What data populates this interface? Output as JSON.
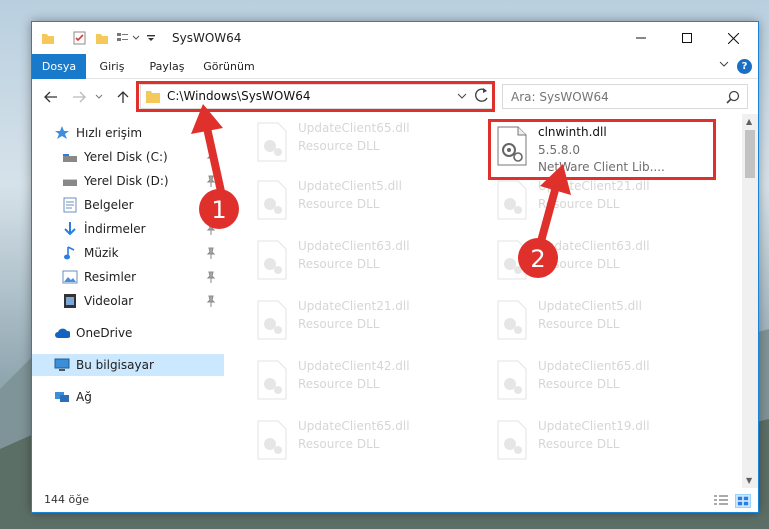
{
  "window": {
    "title": "SysWOW64"
  },
  "ribbon": {
    "tabs": [
      {
        "label": "Dosya",
        "active": true
      },
      {
        "label": "Giriş",
        "active": false
      },
      {
        "label": "Paylaş",
        "active": false
      },
      {
        "label": "Görünüm",
        "active": false
      }
    ],
    "help": "?"
  },
  "address": {
    "path": "C:\\Windows\\SysWOW64"
  },
  "search": {
    "placeholder": "Ara: SysWOW64"
  },
  "sidebar": {
    "items": [
      {
        "label": "Hızlı erişim",
        "icon": "star-icon"
      },
      {
        "label": "Yerel Disk (C:)",
        "icon": "drive-icon"
      },
      {
        "label": "Yerel Disk (D:)",
        "icon": "drive-icon"
      },
      {
        "label": "Belgeler",
        "icon": "documents-icon"
      },
      {
        "label": "İndirmeler",
        "icon": "download-icon"
      },
      {
        "label": "Müzik",
        "icon": "music-icon"
      },
      {
        "label": "Resimler",
        "icon": "pictures-icon"
      },
      {
        "label": "Videolar",
        "icon": "videos-icon"
      },
      {
        "label": "OneDrive",
        "icon": "cloud-icon"
      },
      {
        "label": "Bu bilgisayar",
        "icon": "computer-icon"
      },
      {
        "label": "Ağ",
        "icon": "network-icon"
      }
    ]
  },
  "files": {
    "left": [
      {
        "name": "UpdateClient65.dll",
        "desc": "Resource DLL"
      },
      {
        "name": "UpdateClient5.dll",
        "desc": "Resource DLL"
      },
      {
        "name": "UpdateClient63.dll",
        "desc": "Resource DLL"
      },
      {
        "name": "UpdateClient21.dll",
        "desc": "Resource DLL"
      },
      {
        "name": "UpdateClient42.dll",
        "desc": "Resource DLL"
      },
      {
        "name": "UpdateClient65.dll",
        "desc": "Resource DLL"
      }
    ],
    "highlight": {
      "name": "clnwinth.dll",
      "version": "5.5.8.0",
      "desc": "NetWare Client Lib...."
    },
    "right": [
      {
        "name": "UpdateClient21.dll",
        "desc": "Resource DLL"
      },
      {
        "name": "UpdateClient63.dll",
        "desc": "Resource DLL"
      },
      {
        "name": "UpdateClient5.dll",
        "desc": "Resource DLL"
      },
      {
        "name": "UpdateClient65.dll",
        "desc": "Resource DLL"
      },
      {
        "name": "UpdateClient19.dll",
        "desc": "Resource DLL"
      }
    ]
  },
  "status": {
    "count": "144 öğe"
  },
  "annotations": {
    "step1": "1",
    "step2": "2",
    "color": "#e0302c"
  }
}
